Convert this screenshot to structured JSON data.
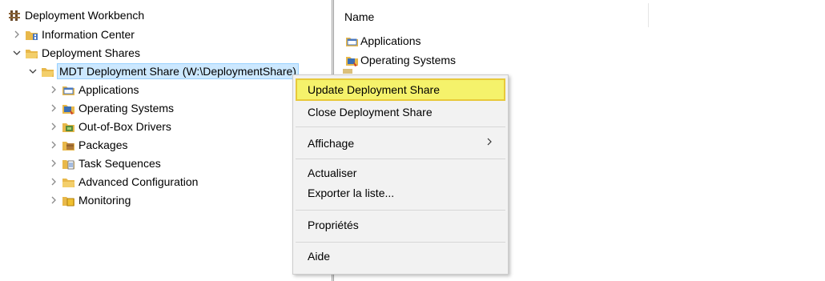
{
  "tree": {
    "root_label": "Deployment Workbench",
    "information_center": "Information Center",
    "deployment_shares": "Deployment Shares",
    "mdt_share": "MDT Deployment Share (W:\\DeploymentShare)",
    "children": [
      {
        "label": "Applications",
        "icon": "applications-folder-icon"
      },
      {
        "label": "Operating Systems",
        "icon": "operating-systems-folder-icon"
      },
      {
        "label": "Out-of-Box Drivers",
        "icon": "drivers-folder-icon"
      },
      {
        "label": "Packages",
        "icon": "packages-folder-icon"
      },
      {
        "label": "Task Sequences",
        "icon": "task-sequences-folder-icon"
      },
      {
        "label": "Advanced Configuration",
        "icon": "advanced-configuration-folder-icon"
      },
      {
        "label": "Monitoring",
        "icon": "monitoring-folder-icon"
      }
    ]
  },
  "list": {
    "column_name": "Name",
    "items": [
      "Applications",
      "Operating Systems"
    ]
  },
  "context_menu": {
    "update": "Update Deployment Share",
    "close": "Close Deployment Share",
    "affichage": "Affichage",
    "actualiser": "Actualiser",
    "exporter": "Exporter la liste...",
    "proprietes": "Propriétés",
    "aide": "Aide"
  },
  "colors": {
    "selection": "#cce8ff",
    "menu_highlight": "#f5f26b",
    "folder": "#e8b84a"
  }
}
